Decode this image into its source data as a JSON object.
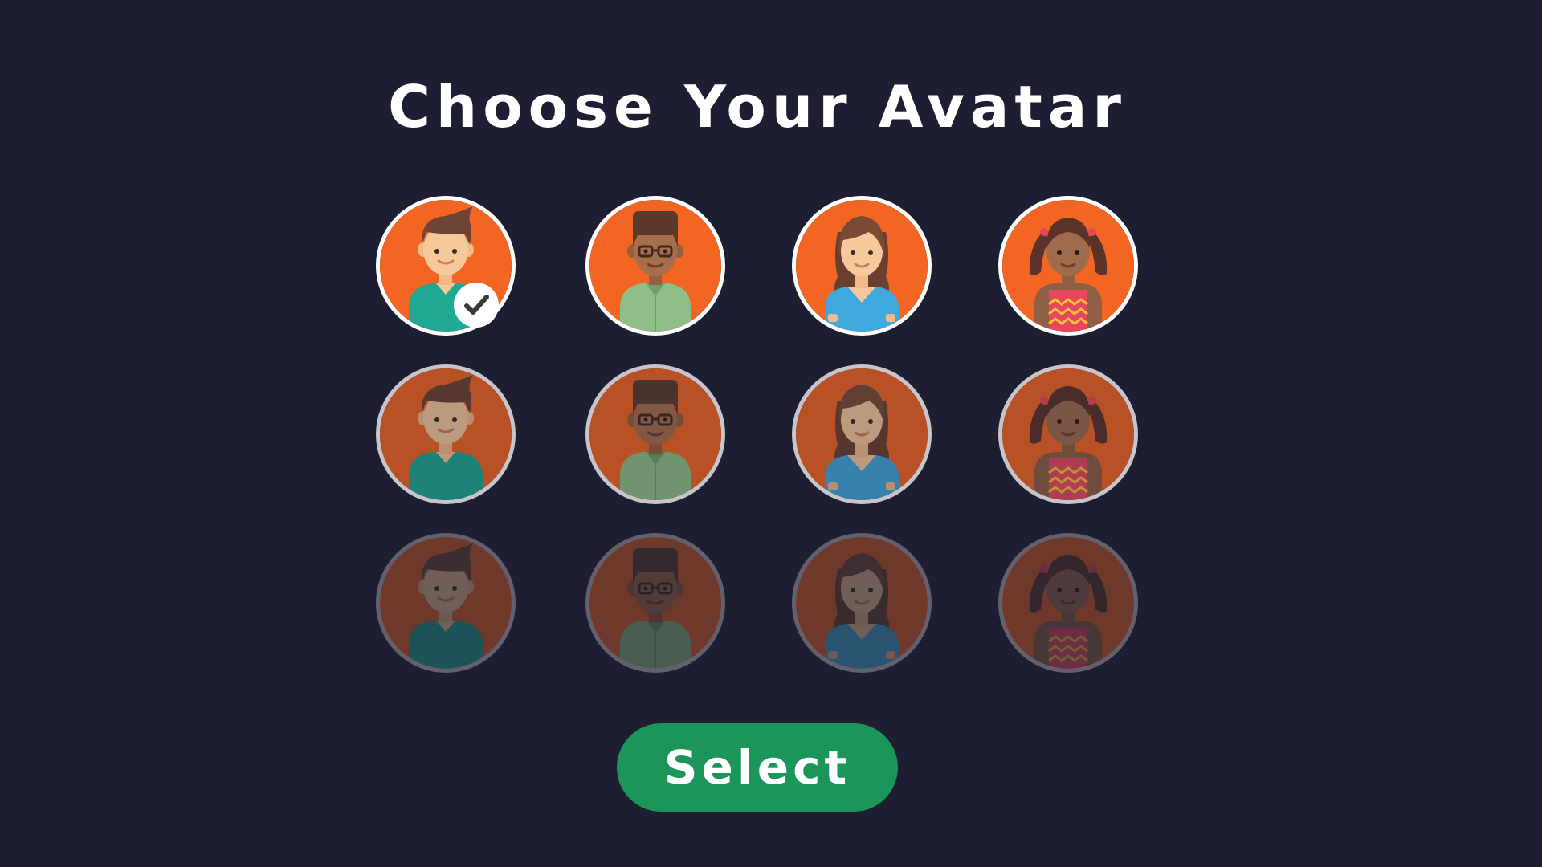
{
  "title": "Choose Your Avatar",
  "select_label": "Select",
  "selected_avatar": "avatar-r1-boy-1",
  "colors": {
    "background": "#1d1e31",
    "tile_background": "#f26522",
    "button": "#1b955a",
    "text": "#ffffff"
  },
  "avatar_grid": {
    "rows": 3,
    "columns": 4,
    "characters": [
      "boy-brown-hair",
      "boy-glasses",
      "girl-long-hair",
      "girl-pigtails"
    ]
  },
  "icons": {
    "check": "check-icon"
  }
}
